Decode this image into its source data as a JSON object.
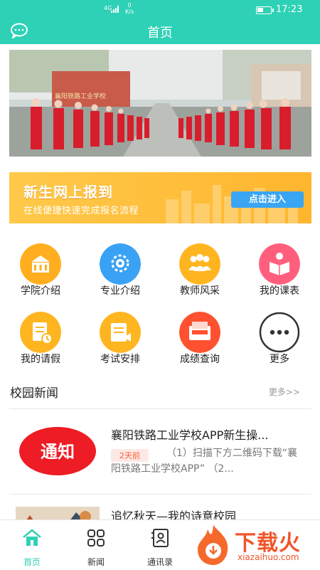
{
  "status": {
    "network": "4G",
    "speed_value": "0",
    "speed_unit": "K/s",
    "time": "17:23"
  },
  "header": {
    "title": "首页",
    "chat_icon": "chat-bubble-icon"
  },
  "banner": {
    "slides": 3,
    "active_slide": 3,
    "sign_text": "襄阳铁路工业学校"
  },
  "promo": {
    "headline": "新生网上报到",
    "subtitle": "在线便捷快速完成报名流程",
    "cta": "点击进入"
  },
  "menu": [
    {
      "label": "学院介绍",
      "icon": "building-icon",
      "color": "#ffae1f"
    },
    {
      "label": "专业介绍",
      "icon": "gear-badge-icon",
      "color": "#3aa2f5"
    },
    {
      "label": "教师风采",
      "icon": "people-icon",
      "color": "#ffb51f"
    },
    {
      "label": "我的课表",
      "icon": "book-reader-icon",
      "color": "#ff5f7d"
    },
    {
      "label": "我的请假",
      "icon": "leave-note-icon",
      "color": "#ffb51f"
    },
    {
      "label": "考试安排",
      "icon": "exam-icon",
      "color": "#ffb51f"
    },
    {
      "label": "成绩查询",
      "icon": "score-icon",
      "color": "#ff5130"
    },
    {
      "label": "更多",
      "icon": "more-dots-icon",
      "color": "#333333"
    }
  ],
  "news_section": {
    "title": "校园新闻",
    "more": "更多>>"
  },
  "news": [
    {
      "title": "襄阳铁路工业学校APP新生操...",
      "badge": "2天前",
      "desc": "（1）扫描下方二维码下载“襄阳铁路工业学校APP” （2...",
      "thumb_text": "通知"
    },
    {
      "title": "追忆秋天—我的诗意校园"
    }
  ],
  "tabs": [
    {
      "label": "首页",
      "icon": "home-icon"
    },
    {
      "label": "新闻",
      "icon": "grid-icon"
    },
    {
      "label": "通讯录",
      "icon": "contacts-icon"
    }
  ],
  "watermark": {
    "text": "下载火",
    "url": "xiazaihuo.com"
  }
}
